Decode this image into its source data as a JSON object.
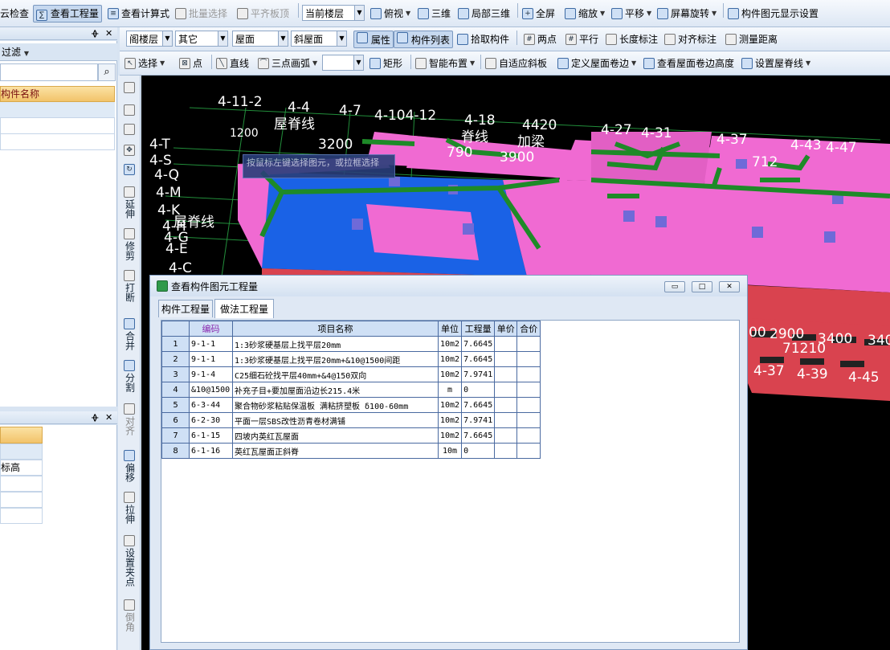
{
  "toolbar1": {
    "check": "云检查",
    "view_qty": "查看工程量",
    "view_formula": "查看计算式",
    "batch_select": "批量选择",
    "flush_top": "平齐板顶",
    "floor_select": "当前楼层",
    "top_view": "俯视",
    "three_d": "三维",
    "local_3d": "局部三维",
    "fullscreen": "全屏",
    "zoom": "缩放",
    "pan": "平移",
    "rotate": "屏幕旋转",
    "display_settings": "构件图元显示设置"
  },
  "toolbar2": {
    "floor": "阁楼层",
    "category": "其它",
    "type": "屋面",
    "sub": "斜屋面",
    "properties": "属性",
    "comp_list": "构件列表",
    "pick": "拾取构件",
    "two_point": "两点",
    "parallel": "平行",
    "length_dim": "长度标注",
    "align_dim": "对齐标注",
    "measure": "测量距离"
  },
  "toolbar3": {
    "select": "选择",
    "point": "点",
    "line": "直线",
    "arc": "三点画弧",
    "rect": "矩形",
    "smart_layout": "智能布置",
    "adaptive_slope": "自适应斜板",
    "define_edge": "定义屋面卷边",
    "view_edge_height": "查看屋面卷边高度",
    "set_ridge": "设置屋脊线"
  },
  "left_panel": {
    "pin": "ᚖ",
    "close": "✕",
    "filter": "过滤",
    "column": "构件名称",
    "column2": "",
    "row_text": "标高"
  },
  "vertical_tools": [
    "延伸",
    "修剪",
    "打断",
    "合并",
    "分割",
    "对齐",
    "偏移",
    "拉伸",
    "设置夹点",
    "倒角"
  ],
  "viewport": {
    "tooltip_line1": "按鼠标左键选择图元，或拉框选择",
    "labels": [
      "4-11-2",
      "4-4",
      "屋脊线",
      "4-7",
      "4-104-12",
      "4-18",
      "脊线",
      "4420",
      "加梁",
      "4-27",
      "4-31",
      "4-37",
      "4-43",
      "4-47",
      "4-T",
      "4-S",
      "4-Q",
      "4-M",
      "4-K",
      "屋脊线",
      "4-H",
      "4-G",
      "4-E",
      "4-C",
      "1200",
      "3200",
      "790",
      "3900",
      "712",
      "2900",
      "3400",
      "340",
      "71210",
      "4-37",
      "4-39",
      "4-45",
      "00"
    ]
  },
  "dialog": {
    "title": "查看构件图元工程量",
    "tab_component": "构件工程量",
    "tab_method": "做法工程量",
    "columns": [
      "编码",
      "项目名称",
      "单位",
      "工程量",
      "单价",
      "合价"
    ],
    "rows": [
      {
        "no": "1",
        "code": "9-1-1",
        "name": "1:3砂浆硬基层上找平层20mm",
        "unit": "10m2",
        "qty": "7.6645",
        "price": "",
        "total": ""
      },
      {
        "no": "2",
        "code": "9-1-1",
        "name": "1:3砂浆硬基层上找平层20mm+&10@1500间距",
        "unit": "10m2",
        "qty": "7.6645",
        "price": "",
        "total": ""
      },
      {
        "no": "3",
        "code": "9-1-4",
        "name": "C25细石砼找平层40mm+&4@150双向",
        "unit": "10m2",
        "qty": "7.9741",
        "price": "",
        "total": ""
      },
      {
        "no": "4",
        "code": "&10@1500",
        "name": "补充子目+要加屋面沿边长215.4米",
        "unit": "m",
        "qty": "0",
        "price": "",
        "total": ""
      },
      {
        "no": "5",
        "code": "6-3-44",
        "name": "聚合物砂浆粘贴保温板 满粘挤塑板 δ100-60mm",
        "unit": "10m2",
        "qty": "7.6645",
        "price": "",
        "total": ""
      },
      {
        "no": "6",
        "code": "6-2-30",
        "name": "平面一层SBS改性沥青卷材满铺",
        "unit": "10m2",
        "qty": "7.9741",
        "price": "",
        "total": ""
      },
      {
        "no": "7",
        "code": "6-1-15",
        "name": "四坡内英红瓦屋面",
        "unit": "10m2",
        "qty": "7.6645",
        "price": "",
        "total": ""
      },
      {
        "no": "8",
        "code": "6-1-16",
        "name": "英红瓦屋面正斜脊",
        "unit": "10m",
        "qty": "0",
        "price": "",
        "total": ""
      }
    ]
  },
  "colors": {
    "roof_pink": "#f06ad2",
    "roof_blue": "#1a62e6",
    "ridge_green": "#1e8a28",
    "wall_red": "#d9434f",
    "grid_lines": "#2bb24a"
  }
}
